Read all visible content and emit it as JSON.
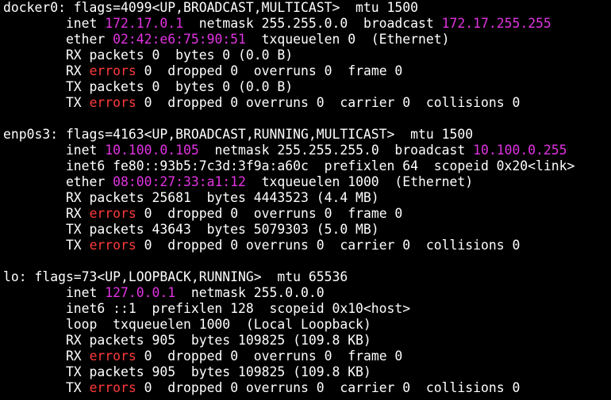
{
  "colors": {
    "background": "#000000",
    "text": "#ffffff",
    "address": "#e233e2",
    "errors": "#ff3a3a"
  },
  "lines": [
    [
      {
        "t": "docker0: flags=4099<UP,BROADCAST,MULTICAST>  mtu 1500",
        "c": "normal"
      }
    ],
    [
      {
        "t": "        inet ",
        "c": "normal"
      },
      {
        "t": "172.17.0.1",
        "c": "ip"
      },
      {
        "t": "  netmask 255.255.0.0  broadcast ",
        "c": "normal"
      },
      {
        "t": "172.17.255.255",
        "c": "ip"
      }
    ],
    [
      {
        "t": "        ether ",
        "c": "normal"
      },
      {
        "t": "02:42:e6:75:90:51",
        "c": "ip"
      },
      {
        "t": "  txqueuelen 0  (Ethernet)",
        "c": "normal"
      }
    ],
    [
      {
        "t": "        RX packets 0  bytes 0 (0.0 B)",
        "c": "normal"
      }
    ],
    [
      {
        "t": "        RX ",
        "c": "normal"
      },
      {
        "t": "errors",
        "c": "err"
      },
      {
        "t": " 0  dropped 0  overruns 0  frame 0",
        "c": "normal"
      }
    ],
    [
      {
        "t": "        TX packets 0  bytes 0 (0.0 B)",
        "c": "normal"
      }
    ],
    [
      {
        "t": "        TX ",
        "c": "normal"
      },
      {
        "t": "errors",
        "c": "err"
      },
      {
        "t": " 0  dropped 0 overruns 0  carrier 0  collisions 0",
        "c": "normal"
      }
    ],
    [
      {
        "t": "",
        "c": "normal"
      }
    ],
    [
      {
        "t": "enp0s3: flags=4163<UP,BROADCAST,RUNNING,MULTICAST>  mtu 1500",
        "c": "normal"
      }
    ],
    [
      {
        "t": "        inet ",
        "c": "normal"
      },
      {
        "t": "10.100.0.105",
        "c": "ip"
      },
      {
        "t": "  netmask 255.255.255.0  broadcast ",
        "c": "normal"
      },
      {
        "t": "10.100.0.255",
        "c": "ip"
      }
    ],
    [
      {
        "t": "        inet6 fe80::93b5:7c3d:3f9a:a60c  prefixlen 64  scopeid 0x20<link>",
        "c": "normal"
      }
    ],
    [
      {
        "t": "        ether ",
        "c": "normal"
      },
      {
        "t": "08:00:27:33:a1:12",
        "c": "ip"
      },
      {
        "t": "  txqueuelen 1000  (Ethernet)",
        "c": "normal"
      }
    ],
    [
      {
        "t": "        RX packets 25681  bytes 4443523 (4.4 MB)",
        "c": "normal"
      }
    ],
    [
      {
        "t": "        RX ",
        "c": "normal"
      },
      {
        "t": "errors",
        "c": "err"
      },
      {
        "t": " 0  dropped 0  overruns 0  frame 0",
        "c": "normal"
      }
    ],
    [
      {
        "t": "        TX packets 43643  bytes 5079303 (5.0 MB)",
        "c": "normal"
      }
    ],
    [
      {
        "t": "        TX ",
        "c": "normal"
      },
      {
        "t": "errors",
        "c": "err"
      },
      {
        "t": " 0  dropped 0 overruns 0  carrier 0  collisions 0",
        "c": "normal"
      }
    ],
    [
      {
        "t": "",
        "c": "normal"
      }
    ],
    [
      {
        "t": "lo: flags=73<UP,LOOPBACK,RUNNING>  mtu 65536",
        "c": "normal"
      }
    ],
    [
      {
        "t": "        inet ",
        "c": "normal"
      },
      {
        "t": "127.0.0.1",
        "c": "ip"
      },
      {
        "t": "  netmask 255.0.0.0",
        "c": "normal"
      }
    ],
    [
      {
        "t": "        inet6 ::1  prefixlen 128  scopeid 0x10<host>",
        "c": "normal"
      }
    ],
    [
      {
        "t": "        loop  txqueuelen 1000  (Local Loopback)",
        "c": "normal"
      }
    ],
    [
      {
        "t": "        RX packets 905  bytes 109825 (109.8 KB)",
        "c": "normal"
      }
    ],
    [
      {
        "t": "        RX ",
        "c": "normal"
      },
      {
        "t": "errors",
        "c": "err"
      },
      {
        "t": " 0  dropped 0  overruns 0  frame 0",
        "c": "normal"
      }
    ],
    [
      {
        "t": "        TX packets 905  bytes 109825 (109.8 KB)",
        "c": "normal"
      }
    ],
    [
      {
        "t": "        TX ",
        "c": "normal"
      },
      {
        "t": "errors",
        "c": "err"
      },
      {
        "t": " 0  dropped 0 overruns 0  carrier 0  collisions 0",
        "c": "normal"
      }
    ]
  ]
}
